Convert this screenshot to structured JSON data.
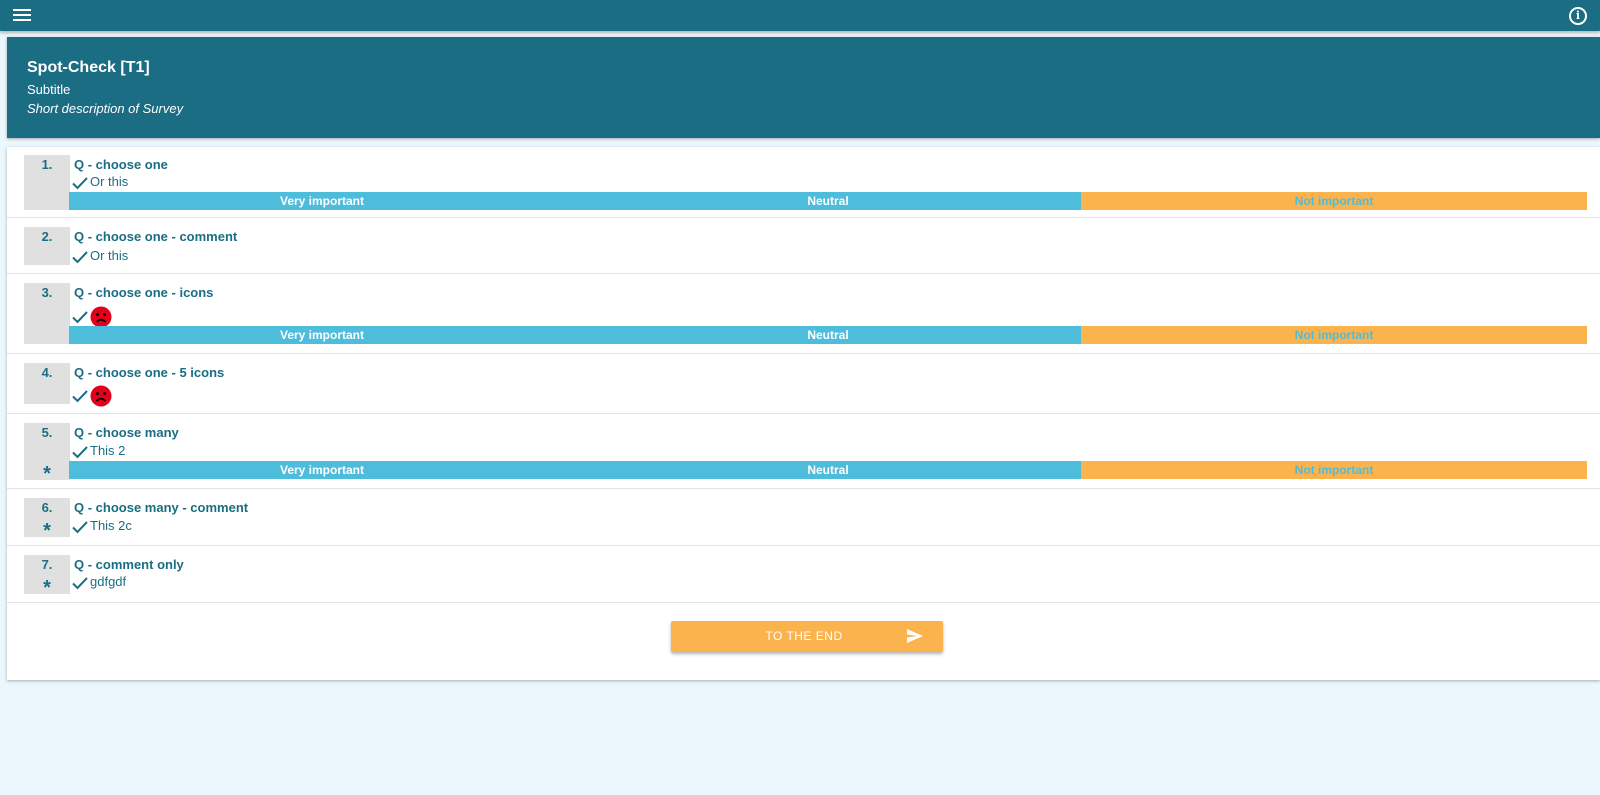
{
  "header": {
    "title": "Spot-Check [T1]",
    "subtitle": "Subtitle",
    "description": "Short description of Survey"
  },
  "scale_labels": {
    "very": "Very important",
    "neutral": "Neutral",
    "not": "Not important"
  },
  "questions": [
    {
      "number": "1.",
      "title": "Q - choose one",
      "answer": "Or this",
      "required": "",
      "has_scale": true
    },
    {
      "number": "2.",
      "title": "Q - choose one - comment",
      "answer": "Or this",
      "required": "",
      "has_scale": false
    },
    {
      "number": "3.",
      "title": "Q - choose one - icons",
      "answer_icon": "sad-face-icon",
      "required": "",
      "has_scale": true
    },
    {
      "number": "4.",
      "title": "Q - choose one - 5 icons",
      "answer_icon": "sad-face-icon",
      "required": "",
      "has_scale": false
    },
    {
      "number": "5.",
      "title": "Q - choose many",
      "answer": "This 2",
      "required": "*",
      "has_scale": true
    },
    {
      "number": "6.",
      "title": "Q - choose many - comment",
      "answer": "This 2c",
      "required": "*",
      "has_scale": false
    },
    {
      "number": "7.",
      "title": "Q - comment only",
      "answer": "gdfgdf",
      "required": "*",
      "has_scale": false
    }
  ],
  "end_button": {
    "label": "TO THE END",
    "icon": "send-icon"
  },
  "icons": {
    "menu": "menu-icon",
    "info": "info-icon",
    "check": "check-icon"
  },
  "colors": {
    "primary": "#1b6d84",
    "accent": "#fbb34d",
    "scale_blue": "#4ebcdb",
    "sad_face": "#e3001b",
    "background": "#ebf7fc"
  }
}
